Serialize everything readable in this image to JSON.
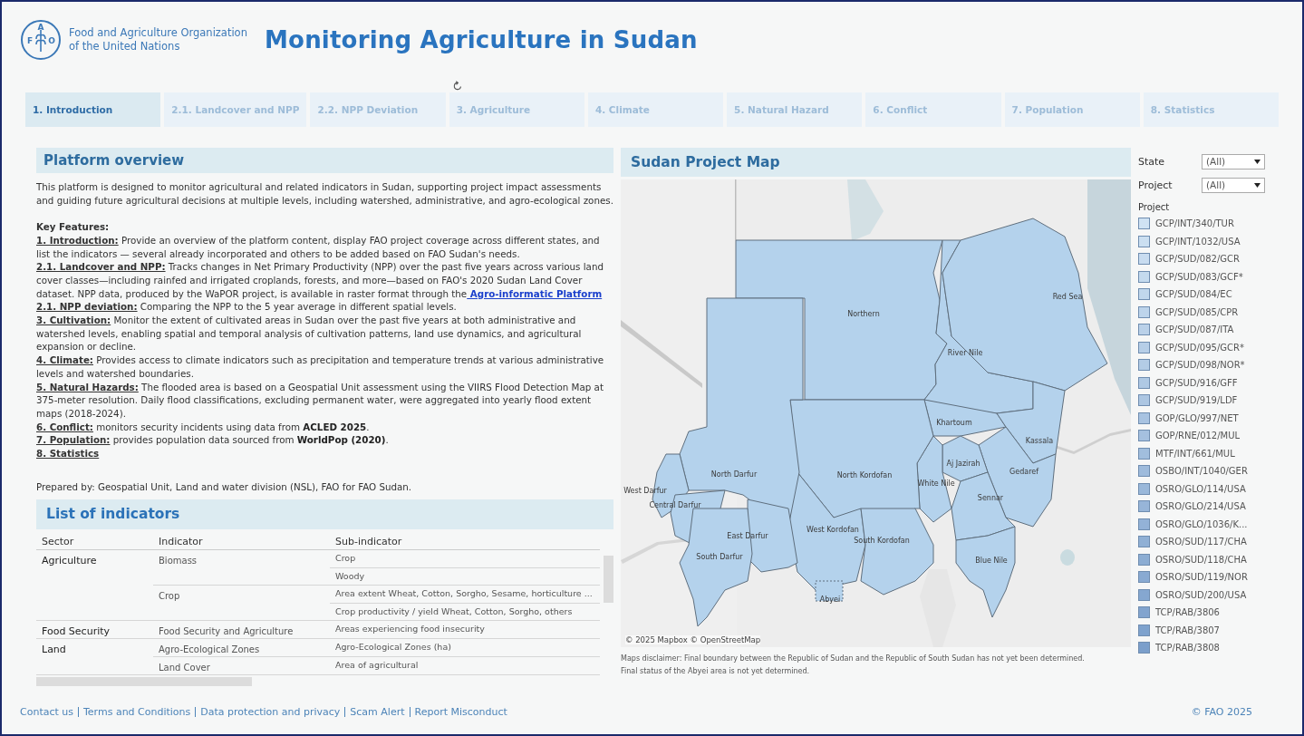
{
  "header": {
    "logo_letters": [
      "F",
      "A",
      "O"
    ],
    "organization": [
      "Food and Agriculture Organization",
      "of the United Nations"
    ],
    "title": "Monitoring Agriculture in Sudan"
  },
  "tabs": [
    {
      "label": "1. Introduction",
      "selected": true
    },
    {
      "label": "2.1. Landcover and NPP",
      "selected": false
    },
    {
      "label": "2.2. NPP Deviation",
      "selected": false
    },
    {
      "label": "3. Agriculture",
      "selected": false
    },
    {
      "label": "4. Climate",
      "selected": false
    },
    {
      "label": "5. Natural Hazard",
      "selected": false
    },
    {
      "label": "6. Conflict",
      "selected": false
    },
    {
      "label": "7. Population",
      "selected": false
    },
    {
      "label": "8. Statistics",
      "selected": false
    }
  ],
  "overview": {
    "title": "Platform overview",
    "intro": "This platform is designed to monitor agricultural and related indicators in Sudan, supporting project impact assessments and guiding future agricultural decisions at multiple levels, including watershed, administrative, and agro-ecological zones.",
    "features_heading": "Key Features:",
    "features": [
      {
        "label": "1. Introduction:",
        "text": " Provide an overview of the platform content, display FAO project coverage across different states, and list the indicators — several already incorporated and others to be added based on FAO Sudan's needs."
      },
      {
        "label": "2.1. Landcover and NPP:",
        "text": " Tracks changes in Net Primary Productivity (NPP) over the past five years across various land cover classes—including rainfed and irrigated croplands, forests, and more—based on FAO's 2020 Sudan Land Cover dataset. NPP data, produced by the WaPOR project, is available in raster format through the",
        "link": " Agro-informatic Platform"
      },
      {
        "label": "2.1. NPP deviation:",
        "text": " Comparing the NPP to the 5 year average in different spatial levels."
      },
      {
        "label": "3. Cultivation:",
        "text": " Monitor the extent of cultivated areas in Sudan over the past five years at both administrative and watershed levels, enabling spatial and temporal analysis of cultivation patterns, land use dynamics, and agricultural expansion or decline."
      },
      {
        "label": "4. Climate:",
        "text": " Provides access to climate indicators such as precipitation and temperature trends at various administrative levels and watershed boundaries."
      },
      {
        "label": "5. Natural Hazards:",
        "text": " The flooded area is based on a Geospatial Unit assessment using the VIIRS Flood Detection Map at 375-meter resolution. Daily flood classifications, excluding permanent water, were aggregated into yearly flood extent maps (2018-2024)."
      },
      {
        "label": "6. Conflict:",
        "text": " monitors security incidents using data from **ACLED 2025**."
      },
      {
        "label": "7. Population:",
        "text": " provides population data sourced from **WorldPop (2020)**."
      },
      {
        "label": "8. Statistics"
      }
    ],
    "prepared_by": "Prepared by: Geospatial Unit, Land and water division (NSL), FAO for FAO Sudan."
  },
  "indicators": {
    "title": "List of indicators",
    "columns": [
      "Sector",
      "Indicator",
      "Sub-indicator"
    ],
    "sectors": [
      {
        "name": "Agriculture",
        "indicators": [
          {
            "name": "Biomass",
            "subs": [
              "Crop",
              "Woody"
            ]
          },
          {
            "name": "Crop",
            "subs": [
              "Area extent Wheat, Cotton, Sorgho, Sesame, horticulture ...",
              "Crop productivity / yield Wheat, Cotton, Sorgho, others"
            ]
          }
        ]
      },
      {
        "name": "Food Security",
        "indicators": [
          {
            "name": "Food Security and Agriculture",
            "subs": [
              "Areas experiencing food insecurity"
            ]
          }
        ]
      },
      {
        "name": "Land",
        "indicators": [
          {
            "name": "Agro-Ecological Zones",
            "subs": [
              "Agro-Ecological Zones (ha)"
            ]
          },
          {
            "name": "Land Cover",
            "subs": [
              "Area of agricultural"
            ]
          }
        ]
      }
    ]
  },
  "map": {
    "title": "Sudan Project Map",
    "states": [
      "Northern",
      "River Nile",
      "Red Sea",
      "Khartoum",
      "Kassala",
      "Gedaref",
      "Aj Jazirah",
      "White Nile",
      "Sennar",
      "Blue Nile",
      "North Kordofan",
      "West Kordofan",
      "South Kordofan",
      "Abyei",
      "North Darfur",
      "West Darfur",
      "Central Darfur",
      "East Darfur",
      "South Darfur"
    ],
    "attribution": "© 2025 Mapbox © OpenStreetMap",
    "disclaimer": [
      "Maps disclaimer: Final boundary between the Republic of Sudan and the Republic of South Sudan has not yet been determined.",
      "Final status of the Abyei area is not yet determined."
    ]
  },
  "filters": {
    "dropdowns": [
      {
        "label": "State",
        "value": "(All)"
      },
      {
        "label": "Project",
        "value": "(All)"
      }
    ],
    "legend_title": "Project",
    "projects": [
      {
        "name": "GCP/INT/340/TUR",
        "color": "#cfe2f3"
      },
      {
        "name": "GCP/INT/1032/USA",
        "color": "#cbdff1"
      },
      {
        "name": "GCP/SUD/082/GCR",
        "color": "#c8dcf0"
      },
      {
        "name": "GCP/SUD/083/GCF*",
        "color": "#c4daee"
      },
      {
        "name": "GCP/SUD/084/EC",
        "color": "#c1d7ec"
      },
      {
        "name": "GCP/SUD/085/CPR",
        "color": "#bdd4eb"
      },
      {
        "name": "GCP/SUD/087/ITA",
        "color": "#bad1e9"
      },
      {
        "name": "GCP/SUD/095/GCR*",
        "color": "#b6cee7"
      },
      {
        "name": "GCP/SUD/098/NOR*",
        "color": "#b3cce6"
      },
      {
        "name": "GCP/SUD/916/GFF",
        "color": "#afc9e4"
      },
      {
        "name": "GCP/SUD/919/LDF",
        "color": "#acc6e2"
      },
      {
        "name": "GOP/GLO/997/NET",
        "color": "#a8c3e1"
      },
      {
        "name": "GOP/RNE/012/MUL",
        "color": "#a5c0df"
      },
      {
        "name": "MTF/INT/661/MUL",
        "color": "#a1bedd"
      },
      {
        "name": "OSBO/INT/1040/GER",
        "color": "#9ebbdc"
      },
      {
        "name": "OSRO/GLO/114/USA",
        "color": "#9ab8da"
      },
      {
        "name": "OSRO/GLO/214/USA",
        "color": "#97b5d8"
      },
      {
        "name": "OSRO/GLO/1036/K...",
        "color": "#93b2d7"
      },
      {
        "name": "OSRO/SUD/117/CHA",
        "color": "#90b0d5"
      },
      {
        "name": "OSRO/SUD/118/CHA",
        "color": "#8cadd3"
      },
      {
        "name": "OSRO/SUD/119/NOR",
        "color": "#89aad2"
      },
      {
        "name": "OSRO/SUD/200/USA",
        "color": "#85a7d0"
      },
      {
        "name": "TCP/RAB/3806",
        "color": "#82a4ce"
      },
      {
        "name": "TCP/RAB/3807",
        "color": "#7ea2cd"
      },
      {
        "name": "TCP/RAB/3808",
        "color": "#7b9fcb"
      }
    ]
  },
  "footer": {
    "links": [
      "Contact us",
      "Terms and Conditions",
      "Data protection and privacy",
      "Scam Alert",
      "Report Misconduct"
    ],
    "copyright": "© FAO 2025"
  }
}
